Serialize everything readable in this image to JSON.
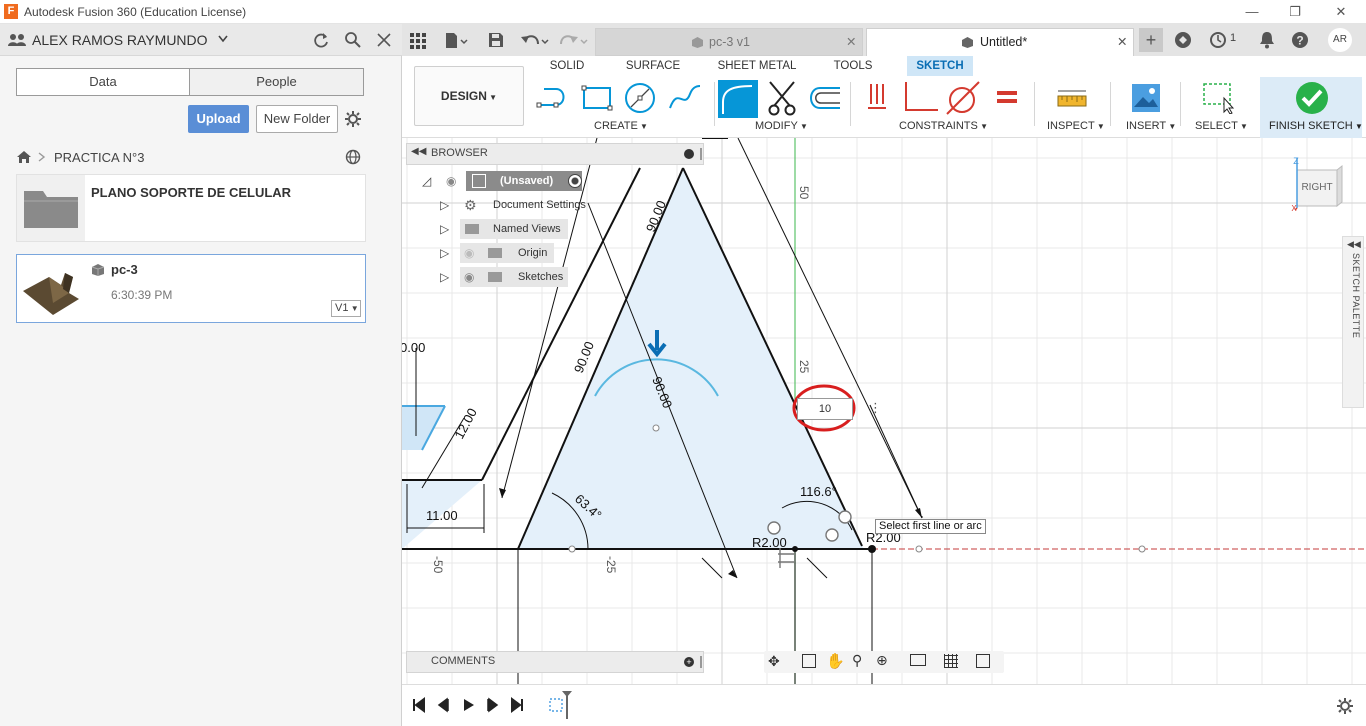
{
  "window": {
    "title": "Autodesk Fusion 360 (Education License)",
    "logo_letter": "F",
    "minimize": "—",
    "restore": "❐",
    "close": "✕"
  },
  "data_panel": {
    "user_name": "ALEX RAMOS RAYMUNDO",
    "tabs": [
      "Data",
      "People"
    ],
    "upload_label": "Upload",
    "new_folder_label": "New Folder",
    "project_name": "PRACTICA N°3",
    "items": [
      {
        "title": "PLANO SOPORTE DE CELULAR",
        "type": "folder"
      },
      {
        "title": "pc-3",
        "subtitle": "6:30:39 PM",
        "version": "V1"
      }
    ]
  },
  "tabs": {
    "items": [
      {
        "label": "pc-3 v1",
        "active": false
      },
      {
        "label": "Untitled*",
        "active": true
      }
    ],
    "close_glyph": "✕",
    "job_count": "1",
    "avatar": "AR"
  },
  "toolbar": {
    "workspace": "DESIGN",
    "workspace_tabs": [
      "SOLID",
      "SURFACE",
      "SHEET METAL",
      "TOOLS",
      "SKETCH"
    ],
    "active_tab": "SKETCH",
    "groups": {
      "create": "CREATE",
      "modify": "MODIFY",
      "constraints": "CONSTRAINTS",
      "inspect": "INSPECT",
      "insert": "INSERT",
      "select": "SELECT",
      "finish": "FINISH SKETCH"
    },
    "accent_color": "#0696d7",
    "finish_color": "#29b14a"
  },
  "browser": {
    "title": "BROWSER",
    "root": "(Unsaved)",
    "nodes": [
      "Document Settings",
      "Named Views",
      "Origin",
      "Sketches"
    ]
  },
  "comments": {
    "title": "COMMENTS"
  },
  "viewcube": {
    "face": "RIGHT",
    "axis_z": "Z",
    "axis_x": "X"
  },
  "sketch_palette": {
    "label": "SKETCH PALETTE"
  },
  "canvas": {
    "tooltip": "Select first line or arc",
    "dimension_input": "10",
    "dimensions": {
      "d_top": "90.00",
      "d_left": "90.00",
      "d_center": "90.00",
      "d_12": "12.00",
      "d_11": "11.00",
      "d_100": "0.00",
      "angle_1": "63.4°",
      "angle_2": "116.6°",
      "r_1": "R2.00",
      "r_2": "R2.00",
      "axis_50": "50",
      "axis_25": "25",
      "axis_m50": "-50",
      "axis_m25": "-25"
    }
  }
}
